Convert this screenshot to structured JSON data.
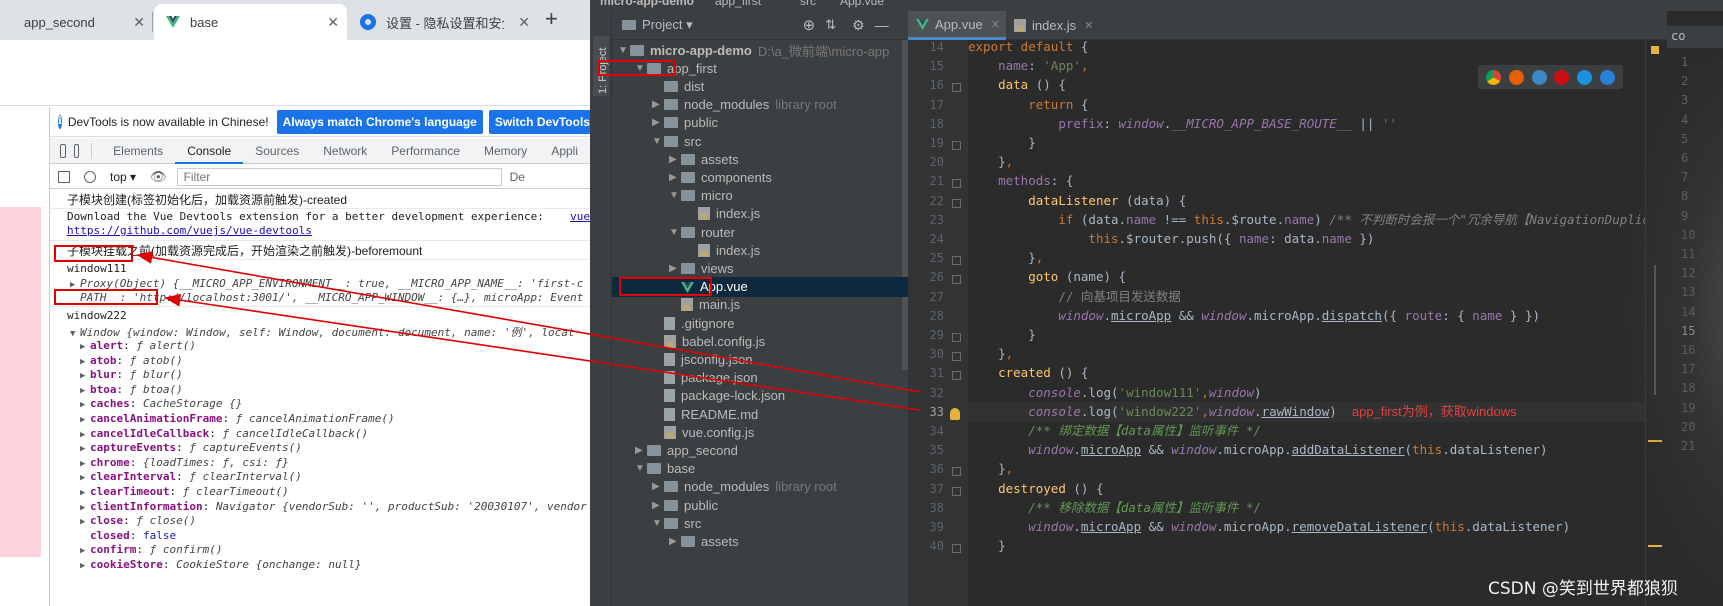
{
  "chrome": {
    "tabs": [
      {
        "title": "app_second",
        "close": "✕"
      },
      {
        "title": "base",
        "close": "✕"
      },
      {
        "title": "设置 - 隐私设置和安全",
        "close": "✕"
      }
    ],
    "new_tab": "+",
    "infobar": {
      "message": "DevTools is now available in Chinese!",
      "btn_match": "Always match Chrome's language",
      "btn_switch": "Switch DevTools to C"
    },
    "devtools_tabs": [
      "Elements",
      "Console",
      "Sources",
      "Network",
      "Performance",
      "Memory",
      "Appli"
    ],
    "active_devtools_tab": "Console",
    "toolbar": {
      "context": "top ▾",
      "filter_placeholder": "Filter",
      "levels": "De"
    },
    "console": {
      "line1": "子模块创建(标签初始化后，加载资源前触发)-created",
      "line2": "Download the Vue Devtools extension for a better development experience:",
      "line2_src": "vue",
      "line2_link": "https://github.com/vuejs/vue-devtools",
      "line3": "子模块挂载之前(加载资源完成后，开始渲染之前触发)-beforemount",
      "w111": "window111",
      "proxy_a": "Proxy(Object) {__MICRO_APP_ENVIRONMENT__: true, __MICRO_APP_NAME__: 'first-c",
      "proxy_b": "PATH__: 'http://localhost:3001/', __MICRO_APP_WINDOW__: {…}, microApp: Event",
      "w222": "window222",
      "window_line": "Window {window: Window, self: Window, document: document, name: '例', locat",
      "props": [
        {
          "k": "alert",
          "v": "ƒ alert()"
        },
        {
          "k": "atob",
          "v": "ƒ atob()"
        },
        {
          "k": "blur",
          "v": "ƒ blur()"
        },
        {
          "k": "btoa",
          "v": "ƒ btoa()"
        },
        {
          "k": "caches",
          "v": "CacheStorage {}"
        },
        {
          "k": "cancelAnimationFrame",
          "v": "ƒ cancelAnimationFrame()"
        },
        {
          "k": "cancelIdleCallback",
          "v": "ƒ cancelIdleCallback()"
        },
        {
          "k": "captureEvents",
          "v": "ƒ captureEvents()"
        },
        {
          "k": "chrome",
          "v": "{loadTimes: ƒ, csi: ƒ}"
        },
        {
          "k": "clearInterval",
          "v": "ƒ clearInterval()"
        },
        {
          "k": "clearTimeout",
          "v": "ƒ clearTimeout()"
        },
        {
          "k": "clientInformation",
          "v": "Navigator {vendorSub: '', productSub: '20030107', vendor"
        },
        {
          "k": "close",
          "v": "ƒ close()"
        },
        {
          "k": "closed",
          "v": "false"
        },
        {
          "k": "confirm",
          "v": "ƒ confirm()"
        },
        {
          "k": "cookieStore",
          "v": "CookieStore {onchange: null}"
        }
      ]
    }
  },
  "idea": {
    "title_parts": [
      "micro-app-demo",
      "app_first",
      "src",
      "App.vue"
    ],
    "sidebar_label": "1: Project",
    "project_header": "Project ▾",
    "tree": [
      {
        "label": "micro-app-demo",
        "extra": "D:\\a_微前端\\micro-app",
        "indent": 0,
        "arrow": "▼",
        "icon": "folder",
        "bold": true
      },
      {
        "label": "app_first",
        "extra": "",
        "indent": 1,
        "arrow": "▼",
        "icon": "folder"
      },
      {
        "label": "dist",
        "extra": "",
        "indent": 2,
        "arrow": "",
        "icon": "folder"
      },
      {
        "label": "node_modules",
        "extra": "library root",
        "indent": 2,
        "arrow": "▶",
        "icon": "folder"
      },
      {
        "label": "public",
        "extra": "",
        "indent": 2,
        "arrow": "▶",
        "icon": "folder"
      },
      {
        "label": "src",
        "extra": "",
        "indent": 2,
        "arrow": "▼",
        "icon": "folder"
      },
      {
        "label": "assets",
        "extra": "",
        "indent": 3,
        "arrow": "▶",
        "icon": "folder"
      },
      {
        "label": "components",
        "extra": "",
        "indent": 3,
        "arrow": "▶",
        "icon": "folder"
      },
      {
        "label": "micro",
        "extra": "",
        "indent": 3,
        "arrow": "▼",
        "icon": "folder"
      },
      {
        "label": "index.js",
        "extra": "",
        "indent": 4,
        "arrow": "",
        "icon": "js"
      },
      {
        "label": "router",
        "extra": "",
        "indent": 3,
        "arrow": "▼",
        "icon": "folder"
      },
      {
        "label": "index.js",
        "extra": "",
        "indent": 4,
        "arrow": "",
        "icon": "js"
      },
      {
        "label": "views",
        "extra": "",
        "indent": 3,
        "arrow": "▶",
        "icon": "folder"
      },
      {
        "label": "App.vue",
        "extra": "",
        "indent": 3,
        "arrow": "",
        "icon": "vue",
        "selected": true
      },
      {
        "label": "main.js",
        "extra": "",
        "indent": 3,
        "arrow": "",
        "icon": "js"
      },
      {
        "label": ".gitignore",
        "extra": "",
        "indent": 2,
        "arrow": "",
        "icon": "file"
      },
      {
        "label": "babel.config.js",
        "extra": "",
        "indent": 2,
        "arrow": "",
        "icon": "js"
      },
      {
        "label": "jsconfig.json",
        "extra": "",
        "indent": 2,
        "arrow": "",
        "icon": "file"
      },
      {
        "label": "package.json",
        "extra": "",
        "indent": 2,
        "arrow": "",
        "icon": "file"
      },
      {
        "label": "package-lock.json",
        "extra": "",
        "indent": 2,
        "arrow": "",
        "icon": "file"
      },
      {
        "label": "README.md",
        "extra": "",
        "indent": 2,
        "arrow": "",
        "icon": "file"
      },
      {
        "label": "vue.config.js",
        "extra": "",
        "indent": 2,
        "arrow": "",
        "icon": "js"
      },
      {
        "label": "app_second",
        "extra": "",
        "indent": 1,
        "arrow": "▶",
        "icon": "folder"
      },
      {
        "label": "base",
        "extra": "",
        "indent": 1,
        "arrow": "▼",
        "icon": "folder"
      },
      {
        "label": "node_modules",
        "extra": "library root",
        "indent": 2,
        "arrow": "▶",
        "icon": "folder"
      },
      {
        "label": "public",
        "extra": "",
        "indent": 2,
        "arrow": "▶",
        "icon": "folder"
      },
      {
        "label": "src",
        "extra": "",
        "indent": 2,
        "arrow": "▼",
        "icon": "folder"
      },
      {
        "label": "assets",
        "extra": "",
        "indent": 3,
        "arrow": "▶",
        "icon": "folder"
      }
    ],
    "editor_tabs": [
      {
        "label": "App.vue",
        "close": "✕",
        "active": true
      },
      {
        "label": "index.js",
        "close": "✕",
        "active": false
      }
    ],
    "line_numbers": [
      "14",
      "15",
      "16",
      "17",
      "18",
      "19",
      "20",
      "21",
      "22",
      "23",
      "24",
      "25",
      "26",
      "27",
      "28",
      "29",
      "30",
      "31",
      "32",
      "33",
      "34",
      "35",
      "36",
      "37",
      "38",
      "39",
      "40"
    ],
    "current_line": "33",
    "code": [
      {
        "n": "14",
        "t": [
          [
            "k",
            "export default "
          ],
          [
            "",
            "{"
          ]
        ]
      },
      {
        "n": "15",
        "t": [
          [
            "",
            "    "
          ],
          [
            "p",
            "name"
          ],
          [
            "",
            ": "
          ],
          [
            "s",
            "'App'"
          ],
          [
            "k",
            ","
          ]
        ]
      },
      {
        "n": "16",
        "t": [
          [
            "",
            "    "
          ],
          [
            "f",
            "data"
          ],
          [
            "",
            " () {"
          ]
        ]
      },
      {
        "n": "17",
        "t": [
          [
            "",
            "        "
          ],
          [
            "k",
            "return "
          ],
          [
            "",
            "{"
          ]
        ]
      },
      {
        "n": "18",
        "t": [
          [
            "",
            "            "
          ],
          [
            "p",
            "prefix"
          ],
          [
            "",
            ": "
          ],
          [
            "pi",
            "window"
          ],
          [
            "",
            "."
          ],
          [
            "pi",
            "__MICRO_APP_BASE_ROUTE__"
          ],
          [
            "",
            " || "
          ],
          [
            "s",
            "''"
          ]
        ]
      },
      {
        "n": "19",
        "t": [
          [
            "",
            "        }"
          ]
        ]
      },
      {
        "n": "20",
        "t": [
          [
            "",
            "    }"
          ],
          [
            "k",
            ","
          ]
        ]
      },
      {
        "n": "21",
        "t": [
          [
            "",
            "    "
          ],
          [
            "p",
            "methods"
          ],
          [
            "",
            ": {"
          ]
        ]
      },
      {
        "n": "22",
        "t": [
          [
            "",
            "        "
          ],
          [
            "f",
            "dataListener"
          ],
          [
            "",
            " (data) {"
          ]
        ]
      },
      {
        "n": "23",
        "t": [
          [
            "",
            "            "
          ],
          [
            "k",
            "if "
          ],
          [
            "",
            "(data."
          ],
          [
            "p",
            "name"
          ],
          [
            "",
            " !== "
          ],
          [
            "k",
            "this"
          ],
          [
            "",
            ".$route."
          ],
          [
            "p",
            "name"
          ],
          [
            "",
            ") "
          ],
          [
            "gc",
            "/** 不判断时会报一个\"冗余导航【NavigationDuplic"
          ]
        ]
      },
      {
        "n": "24",
        "t": [
          [
            "",
            "                "
          ],
          [
            "k",
            "this"
          ],
          [
            "",
            ".$router.push({ "
          ],
          [
            "p",
            "name"
          ],
          [
            "",
            ": data."
          ],
          [
            "p",
            "name"
          ],
          [
            "",
            " })"
          ]
        ]
      },
      {
        "n": "25",
        "t": [
          [
            "",
            "        }"
          ],
          [
            "k",
            ","
          ]
        ]
      },
      {
        "n": "26",
        "t": [
          [
            "",
            "        "
          ],
          [
            "f",
            "goto"
          ],
          [
            "",
            " (name) {"
          ]
        ]
      },
      {
        "n": "27",
        "t": [
          [
            "",
            "            "
          ],
          [
            "g",
            "// 向基项目发送数据"
          ]
        ]
      },
      {
        "n": "28",
        "t": [
          [
            "",
            "            "
          ],
          [
            "pi",
            "window"
          ],
          [
            "",
            "."
          ],
          [
            "u",
            "microApp"
          ],
          [
            "",
            " && "
          ],
          [
            "pi",
            "window"
          ],
          [
            "",
            ".microApp."
          ],
          [
            "u",
            "dispatch"
          ],
          [
            "",
            "({ "
          ],
          [
            "p",
            "route"
          ],
          [
            "",
            ": { "
          ],
          [
            "p",
            "name"
          ],
          [
            "",
            " } })"
          ]
        ]
      },
      {
        "n": "29",
        "t": [
          [
            "",
            "        }"
          ]
        ]
      },
      {
        "n": "30",
        "t": [
          [
            "",
            "    }"
          ],
          [
            "k",
            ","
          ]
        ]
      },
      {
        "n": "31",
        "t": [
          [
            "",
            "    "
          ],
          [
            "f",
            "created"
          ],
          [
            "",
            " () {"
          ]
        ]
      },
      {
        "n": "32",
        "t": [
          [
            "",
            "        "
          ],
          [
            "pi",
            "console"
          ],
          [
            "",
            ".log("
          ],
          [
            "s",
            "'window111'"
          ],
          [
            "k",
            ","
          ],
          [
            "pi",
            "window"
          ],
          [
            "",
            ")"
          ]
        ]
      },
      {
        "n": "33",
        "t": [
          [
            "",
            "        "
          ],
          [
            "pi",
            "console"
          ],
          [
            "",
            ".log("
          ],
          [
            "s",
            "'window222'"
          ],
          [
            "k",
            ","
          ],
          [
            "pi",
            "window"
          ],
          [
            "",
            "."
          ],
          [
            "u",
            "rawWindow"
          ],
          [
            "",
            ")  "
          ],
          [
            "hint",
            "app_first为例，获取windows"
          ]
        ]
      },
      {
        "n": "34",
        "t": [
          [
            "",
            "        "
          ],
          [
            "gi",
            "/** 绑定数据【data属性】监听事件 */"
          ]
        ]
      },
      {
        "n": "35",
        "t": [
          [
            "",
            "        "
          ],
          [
            "pi",
            "window"
          ],
          [
            "",
            "."
          ],
          [
            "u",
            "microApp"
          ],
          [
            "",
            " && "
          ],
          [
            "pi",
            "window"
          ],
          [
            "",
            ".microApp."
          ],
          [
            "u",
            "addDataListener"
          ],
          [
            "",
            "("
          ],
          [
            "k",
            "this"
          ],
          [
            "",
            ".dataListener)"
          ]
        ]
      },
      {
        "n": "36",
        "t": [
          [
            "",
            "    }"
          ],
          [
            "k",
            ","
          ]
        ]
      },
      {
        "n": "37",
        "t": [
          [
            "",
            "    "
          ],
          [
            "f",
            "destroyed"
          ],
          [
            "",
            " () {"
          ]
        ]
      },
      {
        "n": "38",
        "t": [
          [
            "",
            "        "
          ],
          [
            "gi",
            "/** 移除数据【data属性】监听事件 */"
          ]
        ]
      },
      {
        "n": "39",
        "t": [
          [
            "",
            "        "
          ],
          [
            "pi",
            "window"
          ],
          [
            "",
            "."
          ],
          [
            "u",
            "microApp"
          ],
          [
            "",
            " && "
          ],
          [
            "pi",
            "window"
          ],
          [
            "",
            ".microApp."
          ],
          [
            "u",
            "removeDataListener"
          ],
          [
            "",
            "("
          ],
          [
            "k",
            "this"
          ],
          [
            "",
            ".dataListener)"
          ]
        ]
      },
      {
        "n": "40",
        "t": [
          [
            "",
            "    }"
          ]
        ]
      }
    ],
    "right_tab": "co",
    "right_numbers": [
      "1",
      "2",
      "3",
      "4",
      "5",
      "6",
      "7",
      "8",
      "9",
      "10",
      "11",
      "12",
      "13",
      "14",
      "15",
      "16",
      "17",
      "18",
      "19",
      "20",
      "21"
    ],
    "right_current": "15"
  },
  "watermark": "CSDN @笑到世界都狼狈",
  "colors": {
    "annotation_red": "#e00000",
    "selection": "#0d293e",
    "chrome_blue": "#1a73e8"
  }
}
